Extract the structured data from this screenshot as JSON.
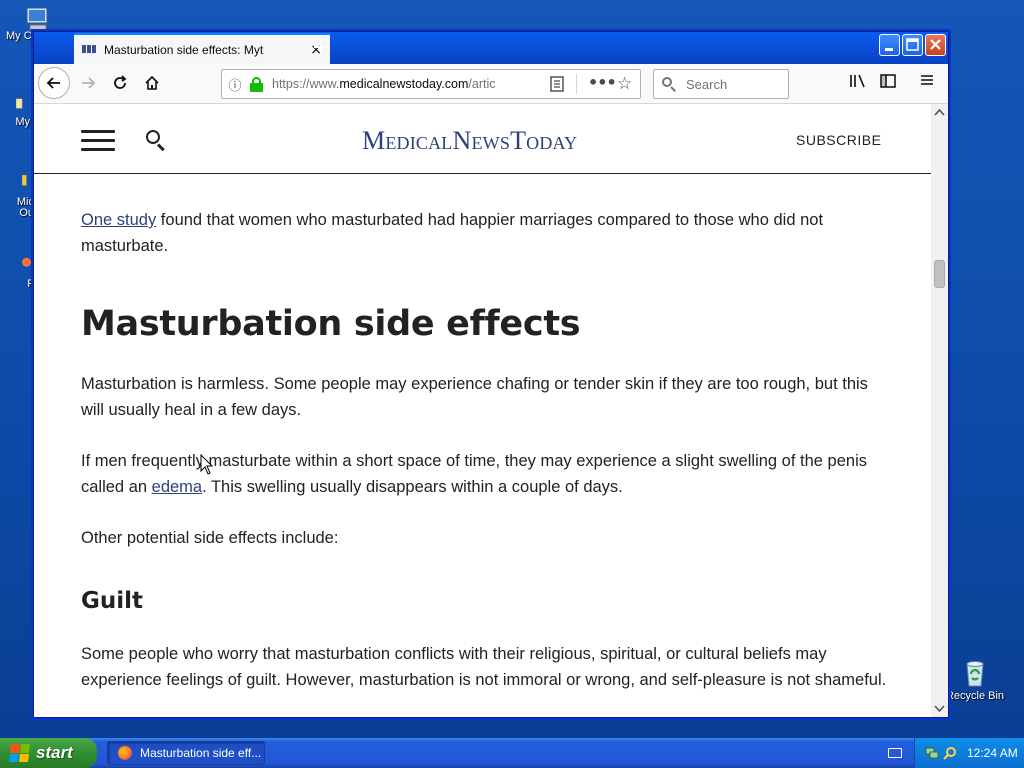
{
  "desktop": {
    "icons": [
      {
        "label": "My C",
        "name": "my-computer"
      },
      {
        "label": "My",
        "name": "my-documents"
      },
      {
        "label": "Mic",
        "label2": "Ou",
        "name": "microsoft-outlook"
      },
      {
        "label": "F",
        "name": "firefox"
      },
      {
        "label": "Recycle Bin",
        "name": "recycle-bin"
      }
    ]
  },
  "browser": {
    "tab_title": "Masturbation side effects: Myths a",
    "tab_close": "×",
    "new_tab": "+",
    "url_prefix": "https://www.",
    "url_domain": "medicalnewstoday.com",
    "url_rest": "/artic",
    "search_placeholder": "Search",
    "buttons": {
      "minimize": "_",
      "maximize": "□",
      "close": "✕",
      "back": "←",
      "forward": "→",
      "reload": "↻",
      "home": "⌂",
      "info": "ⓘ",
      "reader": "▤",
      "more": "•••",
      "star": "☆",
      "library": "|||\\",
      "sidebar": "▣",
      "menu": "≡"
    }
  },
  "site": {
    "logo": "MedicalNewsToday",
    "subscribe": "SUBSCRIBE"
  },
  "article": {
    "p1_link": "One study",
    "p1_rest": " found that women who masturbated had happier marriages compared to those who did not masturbate.",
    "h2": "Masturbation side effects",
    "p2": "Masturbation is harmless. Some people may experience chafing or tender skin if they are too rough, but this will usually heal in a few days.",
    "p3_start": "If men frequently masturbate within a short space of time, they may experience a slight swelling of the penis called an ",
    "p3_link": "edema",
    "p3_end": ". This swelling usually disappears within a couple of days.",
    "p4": "Other potential side effects include:",
    "h3": "Guilt",
    "p5": "Some people who worry that masturbation conflicts with their religious, spiritual, or cultural beliefs may experience feelings of guilt. However, masturbation is not immoral or wrong, and self-pleasure is not shameful."
  },
  "taskbar": {
    "start_label": "start",
    "task_label": "Masturbation side eff...",
    "clock": "12:24 AM"
  },
  "colors": {
    "desktop": "#0d4aa6",
    "titlebar": "#0a4fd8",
    "link": "#2f3f7a",
    "start_green": "#2f8e2f"
  }
}
